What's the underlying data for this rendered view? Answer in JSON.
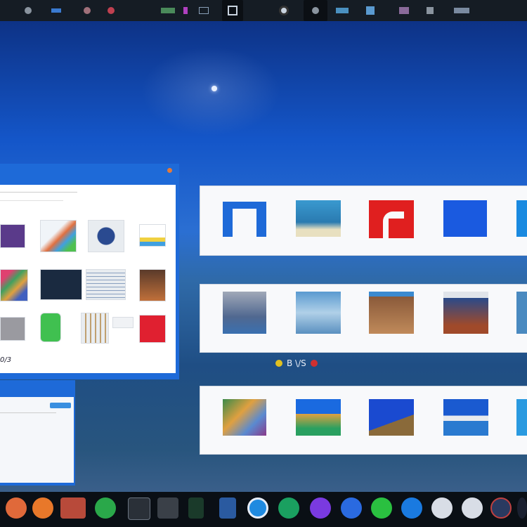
{
  "topbar": {
    "items": [
      {
        "icon": "app-icon-1"
      },
      {
        "icon": "app-icon-2"
      },
      {
        "icon": "app-icon-3"
      },
      {
        "icon": "app-icon-4"
      },
      {
        "icon": "monitor-icon"
      },
      {
        "icon": "terminal-icon"
      },
      {
        "icon": "window-icon"
      },
      {
        "icon": "eye-icon"
      },
      {
        "icon": "camera-icon"
      },
      {
        "icon": "chart-icon"
      },
      {
        "icon": "paint-icon"
      },
      {
        "icon": "grid-icon"
      },
      {
        "icon": "people-icon"
      },
      {
        "icon": "people-icon-2"
      }
    ],
    "label_1": "",
    "label_2": ""
  },
  "left_window": {
    "status_text": "0/3",
    "accent": "#1e6ad8"
  },
  "caption_row": {
    "text": "В \\/S"
  },
  "colors": {
    "top_bar": "#151c24",
    "dock": "#0a0f15",
    "window_frame": "#1e6ad8",
    "sky_top": "#0c2c7a",
    "sky_mid": "#1456c9"
  },
  "dock": {
    "icons": [
      {
        "icon": "browser-orange-icon",
        "color": "#e0693a"
      },
      {
        "icon": "firefox-icon",
        "color": "#e8782a"
      },
      {
        "icon": "store-icon",
        "color": "#b84a3a"
      },
      {
        "icon": "chrome-icon",
        "color": "#2aa84a"
      },
      {
        "icon": "printer-icon",
        "color": "#2a3038"
      },
      {
        "icon": "photo-icon",
        "color": "#3a4048"
      },
      {
        "icon": "phone-icon",
        "color": "#1a3a2a"
      },
      {
        "icon": "files-icon",
        "color": "#2a5aa0"
      },
      {
        "icon": "blue-app-icon",
        "color": "#1f8ae0"
      },
      {
        "icon": "green-app-icon",
        "color": "#1aa060"
      },
      {
        "icon": "purple-app-icon",
        "color": "#7a3ae0"
      },
      {
        "icon": "blue-dot-icon",
        "color": "#2a6ae0"
      },
      {
        "icon": "green-circle-icon",
        "color": "#2ac040"
      },
      {
        "icon": "chat-icon",
        "color": "#1a7ae0"
      },
      {
        "icon": "white-circle-icon",
        "color": "#d8dde6"
      },
      {
        "icon": "record-icon",
        "color": "#d8dde6"
      },
      {
        "icon": "settings-icon",
        "color": "#2a3a60"
      },
      {
        "icon": "menu-icon",
        "color": "#1a2030"
      }
    ]
  }
}
